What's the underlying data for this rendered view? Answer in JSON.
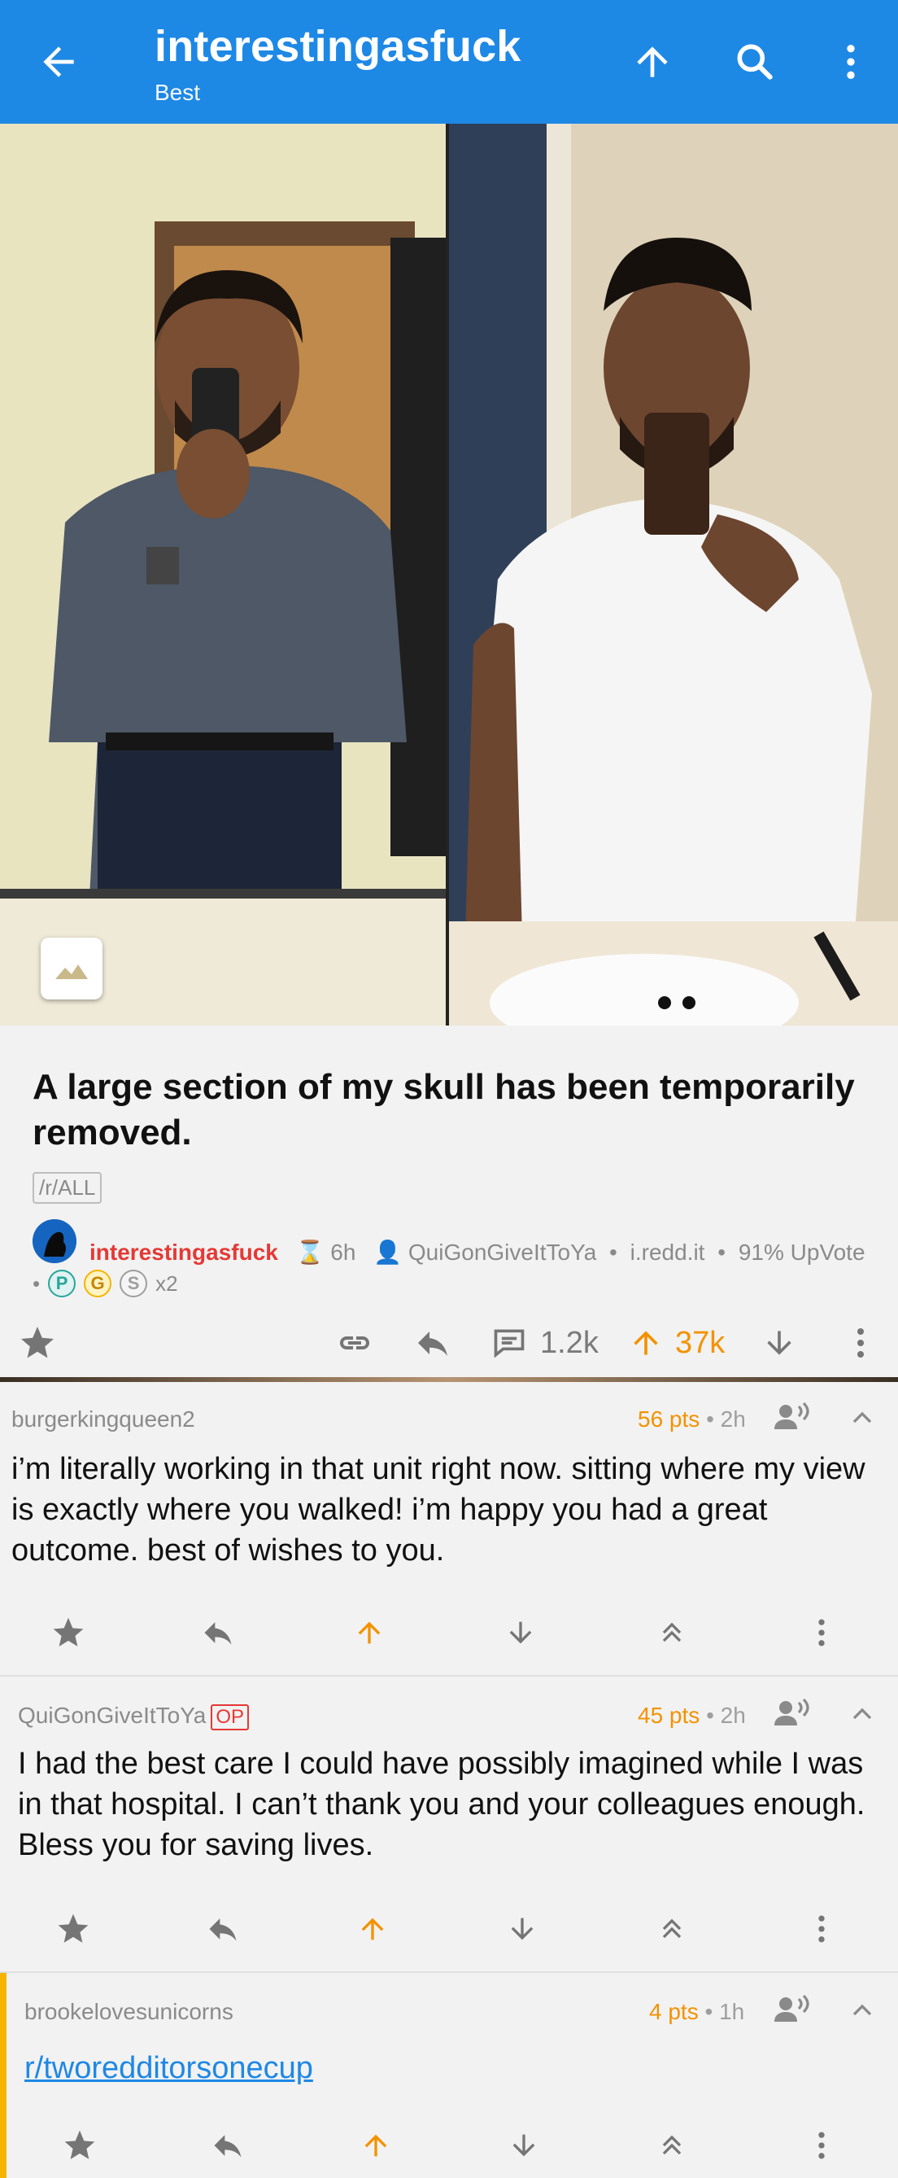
{
  "appbar": {
    "title": "interestingasfuck",
    "subtitle": "Best",
    "icons": [
      "arrow-left-icon",
      "arrow-up-icon",
      "search-icon",
      "more-vert-icon"
    ]
  },
  "post": {
    "title": "A large section of my skull has been temporarily removed.",
    "flair": "/r/ALL",
    "subreddit": "interestingasfuck",
    "age": "6h",
    "author": "QuiGonGiveItToYa",
    "domain": "i.redd.it",
    "upvote_ratio": "91% UpVote",
    "awards_count": "x2",
    "awards": [
      "P",
      "G",
      "S"
    ],
    "comments": "1.2k",
    "score": "37k"
  },
  "comments": [
    {
      "author": "burgerkingqueen2",
      "points": "56 pts",
      "age": "2h",
      "body": "i’m literally working in that unit right now. sitting where my view is exactly where you walked! i’m happy you had a great outcome. best of wishes to you."
    },
    {
      "author": "QuiGonGiveItToYa",
      "op_badge": "OP",
      "points": "45 pts",
      "age": "2h",
      "body": "I had the best care I could have possibly imagined while I was in that hospital. I can’t thank you and your colleagues enough. Bless you for saving lives."
    },
    {
      "author": "brookelovesunicorns",
      "points": "4 pts",
      "age": "1h",
      "body": "r/tworedditorsonecup"
    }
  ],
  "colors": {
    "appbar": "#1e88e5",
    "accent_orange": "#f39200",
    "subreddit_red": "#e53935",
    "link_blue": "#1e88e5",
    "thread_bar": "#f5b400"
  },
  "meta_separator": "•"
}
